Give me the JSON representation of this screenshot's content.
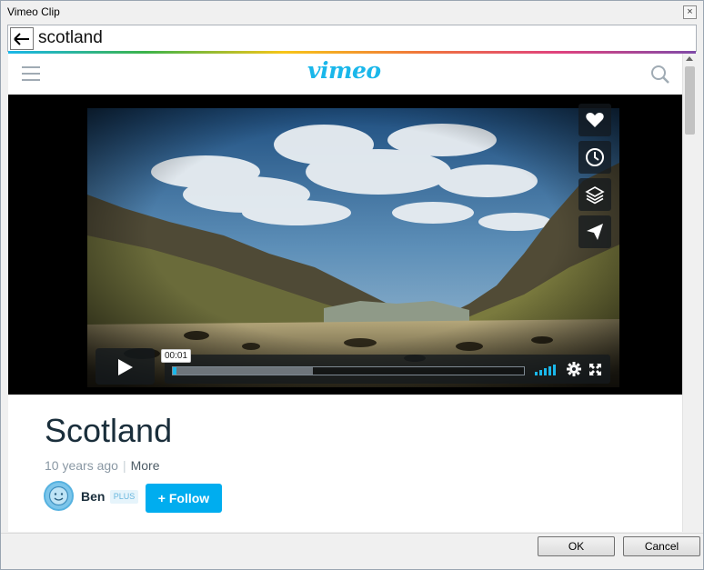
{
  "window": {
    "title": "Vimeo Clip",
    "close_glyph": "×"
  },
  "address": {
    "back_glyph": "←",
    "text": "scotland"
  },
  "header": {
    "logo": "vimeo",
    "menu_icon": "hamburger-menu-icon",
    "search_icon": "search-icon"
  },
  "player": {
    "time_tooltip": "00:01",
    "progress_played_fraction": 0.01,
    "progress_loaded_fraction": 0.4,
    "side_buttons": [
      "heart-icon",
      "clock-icon",
      "layers-icon",
      "send-icon"
    ]
  },
  "video": {
    "title": "Scotland",
    "age": "10 years ago",
    "more": "More",
    "user": "Ben",
    "badge": "PLUS",
    "follow": "+ Follow"
  },
  "dialog": {
    "ok": "OK",
    "cancel": "Cancel"
  },
  "colors": {
    "accent": "#1ab7ea",
    "follow_button": "#00adef",
    "title_text": "#1a2e3b"
  }
}
